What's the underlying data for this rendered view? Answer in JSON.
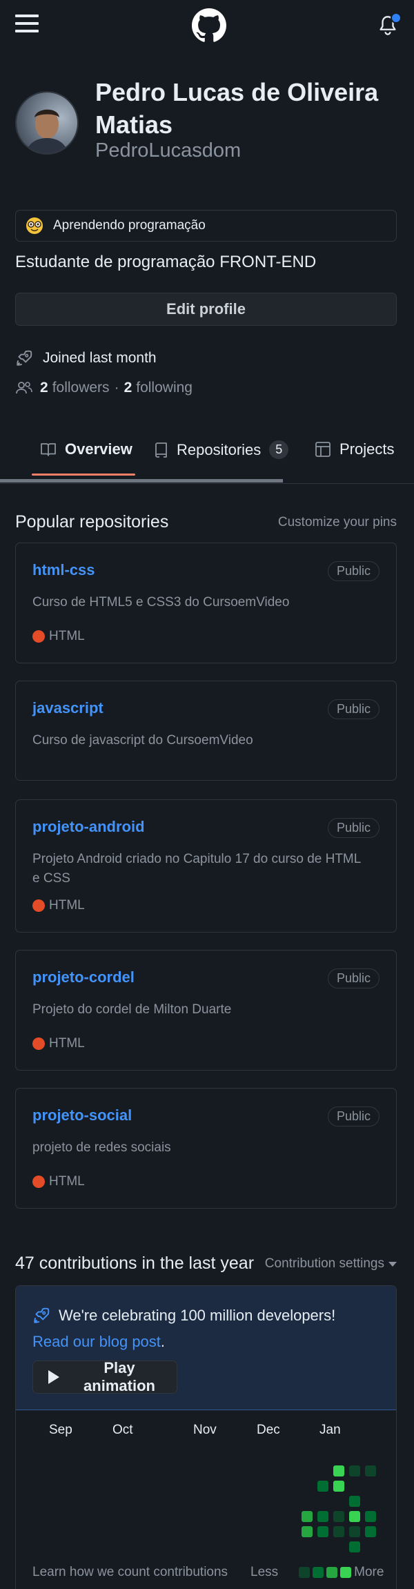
{
  "header": {
    "menu_icon": "hamburger-icon",
    "logo_icon": "github-logo-icon",
    "bell_icon": "bell-icon"
  },
  "profile": {
    "name": "Pedro Lucas de Oliveira Matias",
    "login": "PedroLucasdom",
    "status": "Aprendendo programação",
    "bio": "Estudante de programação FRONT-END",
    "edit_label": "Edit profile",
    "joined": "Joined last month",
    "followers_count": "2",
    "followers_label": "followers",
    "separator": "·",
    "following_count": "2",
    "following_label": "following"
  },
  "tabs": [
    {
      "label": "Overview",
      "icon": "book-icon",
      "active": true
    },
    {
      "label": "Repositories",
      "icon": "repo-icon",
      "count": "5"
    },
    {
      "label": "Projects",
      "icon": "table-icon"
    }
  ],
  "popular": {
    "title": "Popular repositories",
    "customize": "Customize your pins",
    "repos": [
      {
        "name": "html-css",
        "visibility": "Public",
        "description": "Curso de HTML5 e CSS3 do CursoemVideo",
        "language": "HTML"
      },
      {
        "name": "javascript",
        "visibility": "Public",
        "description": "Curso de javascript do CursoemVideo",
        "language": ""
      },
      {
        "name": "projeto-android",
        "visibility": "Public",
        "description": "Projeto Android criado no Capitulo 17 do curso de HTML e CSS",
        "language": "HTML"
      },
      {
        "name": "projeto-cordel",
        "visibility": "Public",
        "description": "Projeto do cordel de Milton Duarte",
        "language": "HTML"
      },
      {
        "name": "projeto-social",
        "visibility": "Public",
        "description": "projeto de redes sociais",
        "language": "HTML"
      }
    ]
  },
  "contributions": {
    "title": "47 contributions in the last year",
    "settings": "Contribution settings",
    "banner_text": "We're celebrating 100 million developers!",
    "banner_link": "Read our blog post",
    "banner_link_suffix": ".",
    "play_label": "Play animation",
    "months": [
      "Sep",
      "Oct",
      "Nov",
      "Dec",
      "Jan"
    ],
    "learn": "Learn how we count contributions",
    "less": "Less",
    "more": "More",
    "colors": {
      "empty": "#161b22",
      "l1": "#0e4429",
      "l2": "#006d32",
      "l3": "#26a641",
      "l4": "#39d353"
    }
  }
}
